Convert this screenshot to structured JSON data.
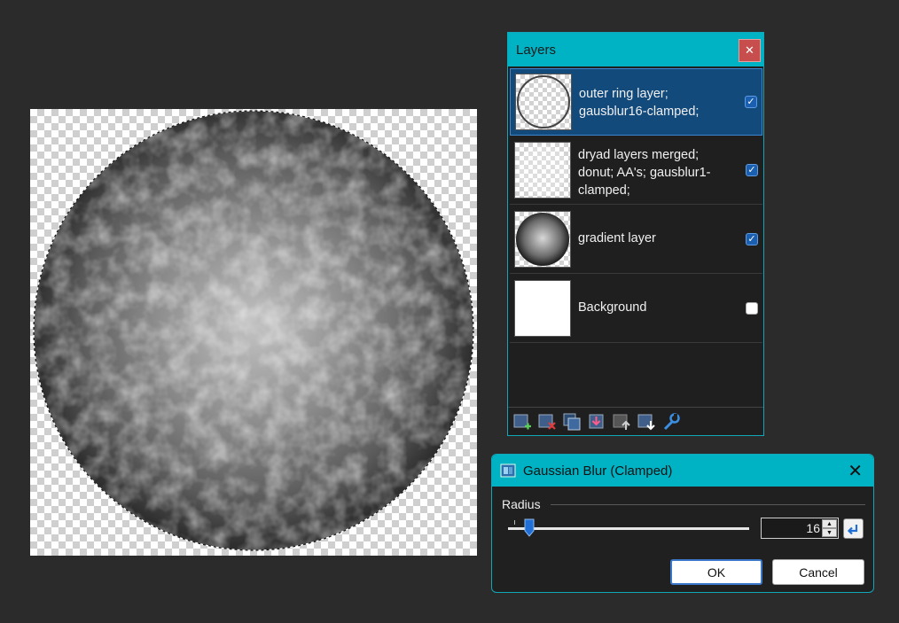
{
  "layers_panel": {
    "title": "Layers",
    "close_glyph": "✕",
    "layers": [
      {
        "name": "outer ring layer;\ngausblur16-clamped;",
        "visible": true,
        "selected": true,
        "thumb": "ring"
      },
      {
        "name": "dryad layers merged;\ndonut; AA's; gausblur1-\nclamped;",
        "visible": true,
        "selected": false,
        "thumb": "faint"
      },
      {
        "name": "gradient layer",
        "visible": true,
        "selected": false,
        "thumb": "gradient"
      },
      {
        "name": "Background",
        "visible": false,
        "selected": false,
        "thumb": "white"
      }
    ],
    "toolbar_icons": [
      "add-layer-icon",
      "delete-layer-icon",
      "duplicate-layer-icon",
      "merge-layer-down-icon",
      "move-layer-up-icon",
      "move-layer-down-icon",
      "layer-properties-icon"
    ]
  },
  "blur_dialog": {
    "title": "Gaussian Blur (Clamped)",
    "close_glyph": "✕",
    "radius_label": "Radius",
    "radius_value": "16",
    "slider_fraction": 0.09,
    "ok_label": "OK",
    "cancel_label": "Cancel"
  },
  "colors": {
    "accent": "#00b3c4",
    "selection": "#134a7c",
    "close_red": "#c84d4d"
  }
}
